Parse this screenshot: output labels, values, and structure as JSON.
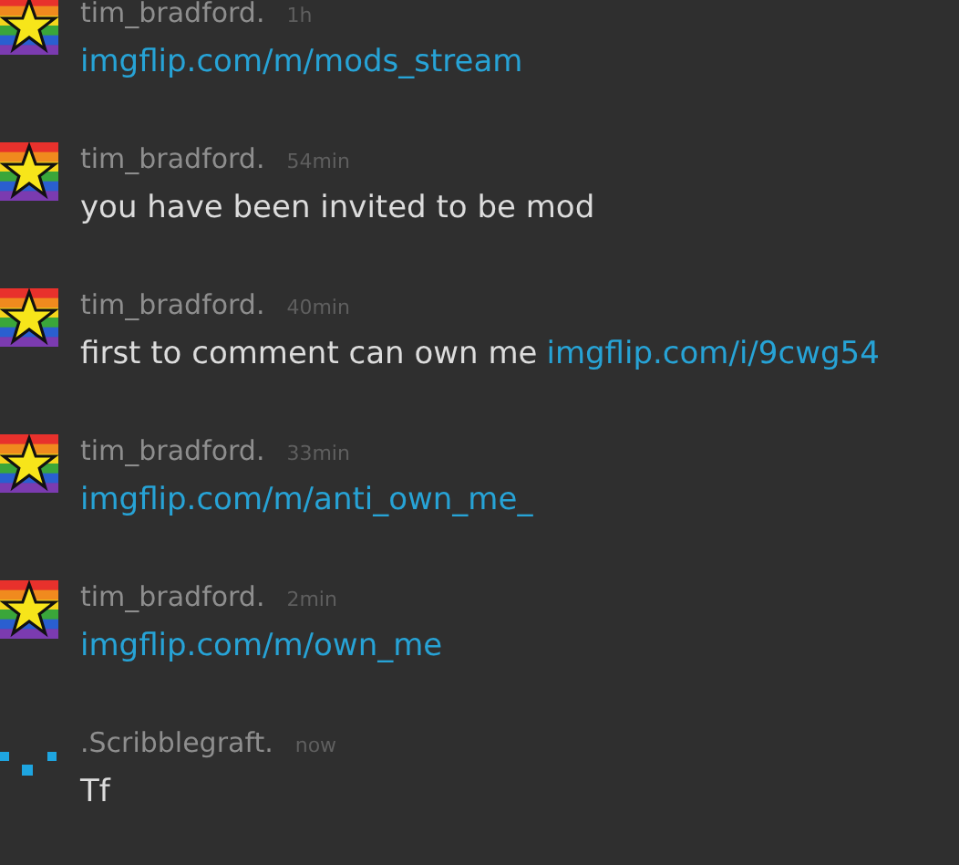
{
  "messages": [
    {
      "author": "tim_bradford.",
      "time": "1h",
      "avatar": {
        "kind": "star"
      },
      "body": [
        {
          "kind": "link",
          "text": "imgflip.com/m/mods_stream"
        }
      ]
    },
    {
      "author": "tim_bradford.",
      "time": "54min",
      "avatar": {
        "kind": "star"
      },
      "body": [
        {
          "kind": "text",
          "text": "you have been invited to be mod"
        }
      ]
    },
    {
      "author": "tim_bradford.",
      "time": "40min",
      "avatar": {
        "kind": "star"
      },
      "body": [
        {
          "kind": "text",
          "text": "first to comment can own me"
        },
        {
          "kind": "link",
          "text": "imgflip.com/i/9cwg54"
        }
      ]
    },
    {
      "author": "tim_bradford.",
      "time": "33min",
      "avatar": {
        "kind": "star"
      },
      "body": [
        {
          "kind": "link",
          "text": "imgflip.com/m/anti_own_me_"
        }
      ]
    },
    {
      "author": "tim_bradford.",
      "time": "2min",
      "avatar": {
        "kind": "star"
      },
      "body": [
        {
          "kind": "link",
          "text": "imgflip.com/m/own_me"
        }
      ]
    },
    {
      "author": ".Scribblegraft.",
      "time": "now",
      "avatar": {
        "kind": "dots"
      },
      "body": [
        {
          "kind": "text",
          "text": "Tf"
        }
      ]
    }
  ]
}
